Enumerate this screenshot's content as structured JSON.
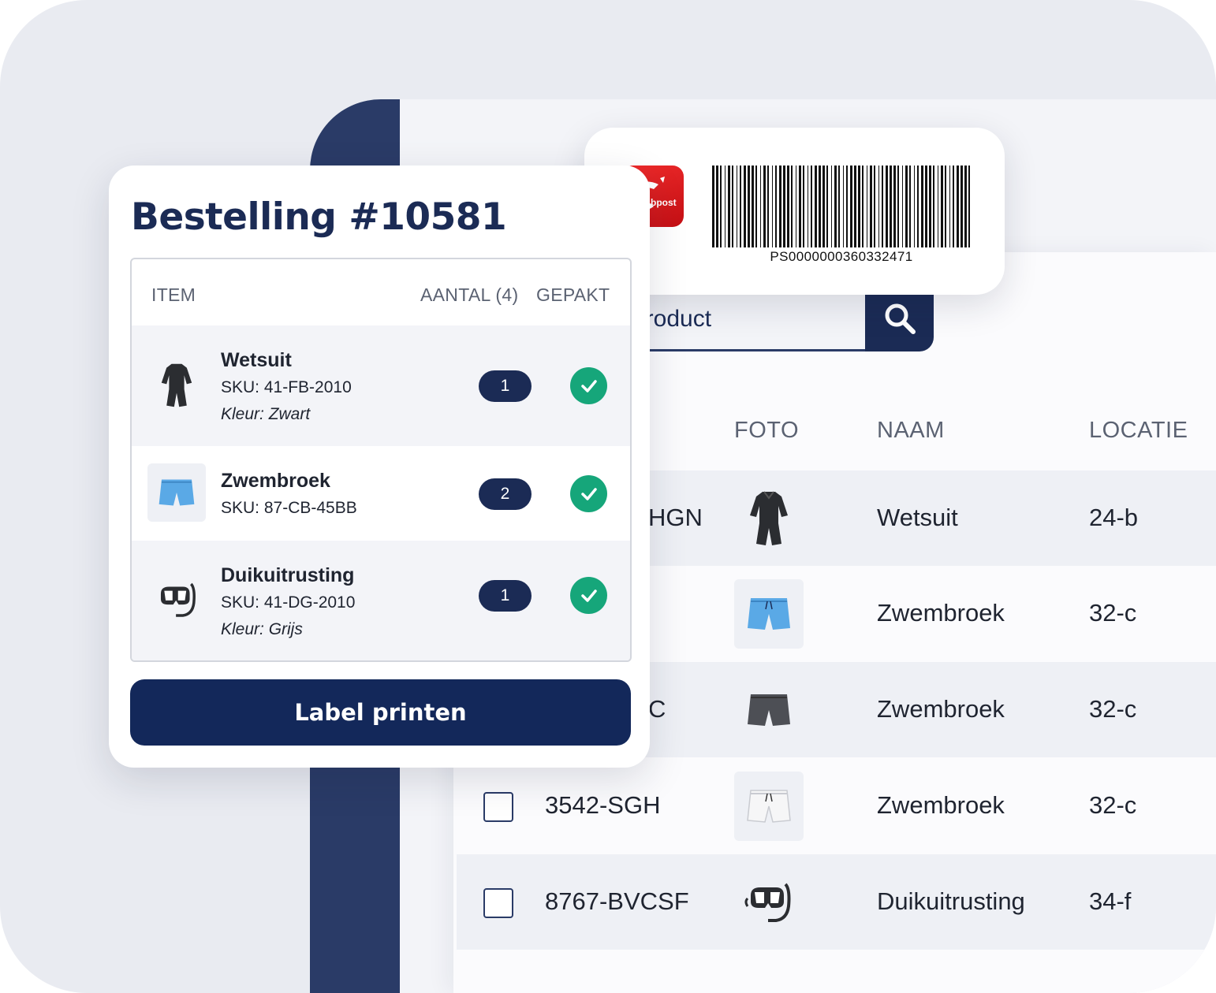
{
  "order": {
    "title": "Bestelling #10581",
    "columns": {
      "item": "ITEM",
      "quantity": "AANTAL (4)",
      "packed": "GEPAKT"
    },
    "items": [
      {
        "name": "Wetsuit",
        "sku": "SKU: 41-FB-2010",
        "color": "Kleur: Zwart",
        "qty": "1",
        "icon": "wetsuit-icon",
        "packed": true
      },
      {
        "name": "Zwembroek",
        "sku": "SKU: 87-CB-45BB",
        "color": "",
        "qty": "2",
        "icon": "swim-shorts-icon",
        "packed": true
      },
      {
        "name": "Duikuitrusting",
        "sku": "SKU: 41-DG-2010",
        "color": "Kleur: Grijs",
        "qty": "1",
        "icon": "snorkel-mask-icon",
        "packed": true
      }
    ],
    "print_button": "Label printen"
  },
  "label": {
    "carrier_logo_text": "bpost",
    "barcode_number": "PS0000000360332471"
  },
  "inventory": {
    "search": {
      "value": "product",
      "icon": "search-icon"
    },
    "columns": {
      "photo": "FOTO",
      "name": "NAAM",
      "location": "LOCATIE"
    },
    "rows": [
      {
        "code": "HGN",
        "name": "Wetsuit",
        "location": "24-b",
        "icon": "wetsuit-icon"
      },
      {
        "code": "",
        "name": "Zwembroek",
        "location": "32-c",
        "icon": "swim-shorts-blue-icon"
      },
      {
        "code": "C",
        "name": "Zwembroek",
        "location": "32-c",
        "icon": "swim-shorts-grey-icon"
      },
      {
        "code": "3542-SGH",
        "name": "Zwembroek",
        "location": "32-c",
        "icon": "swim-shorts-white-icon"
      },
      {
        "code": "8767-BVCSF",
        "name": "Duikuitrusting",
        "location": "34-f",
        "icon": "snorkel-mask-icon"
      }
    ]
  },
  "colors": {
    "navy": "#1b2b55",
    "sidebar": "#2a3b67",
    "success": "#16a67a",
    "bpost_red": "#e4211f"
  }
}
